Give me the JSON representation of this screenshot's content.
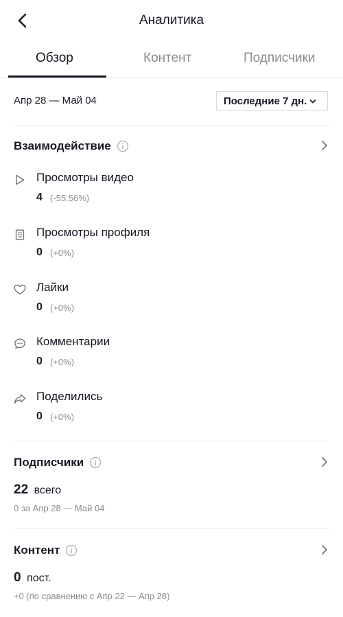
{
  "header": {
    "title": "Аналитика"
  },
  "tabs": [
    {
      "label": "Обзор",
      "active": true
    },
    {
      "label": "Контент",
      "active": false
    },
    {
      "label": "Подписчики",
      "active": false
    }
  ],
  "date_range": "Апр 28 — Май 04",
  "period_select": {
    "selected": "Последние 7 дн."
  },
  "engagement": {
    "title": "Взаимодействие",
    "metrics": [
      {
        "icon": "play-icon",
        "label": "Просмотры видео",
        "value": "4",
        "change": "(-55.56%)"
      },
      {
        "icon": "profile-page-icon",
        "label": "Просмотры профиля",
        "value": "0",
        "change": "(+0%)"
      },
      {
        "icon": "heart-icon",
        "label": "Лайки",
        "value": "0",
        "change": "(+0%)"
      },
      {
        "icon": "comment-icon",
        "label": "Комментарии",
        "value": "0",
        "change": "(+0%)"
      },
      {
        "icon": "share-icon",
        "label": "Поделились",
        "value": "0",
        "change": "(+0%)"
      }
    ]
  },
  "followers": {
    "title": "Подписчики",
    "total_value": "22",
    "total_suffix": "всего",
    "period_note": "0 за Апр 28 — Май 04"
  },
  "content": {
    "title": "Контент",
    "posts_value": "0",
    "posts_suffix": "пост.",
    "comparison_note": "+0 (по сравнению с Апр 22 — Апр 28)"
  },
  "colors": {
    "text_primary": "#161823",
    "text_secondary": "#8a8b91",
    "divider": "#ececed"
  }
}
